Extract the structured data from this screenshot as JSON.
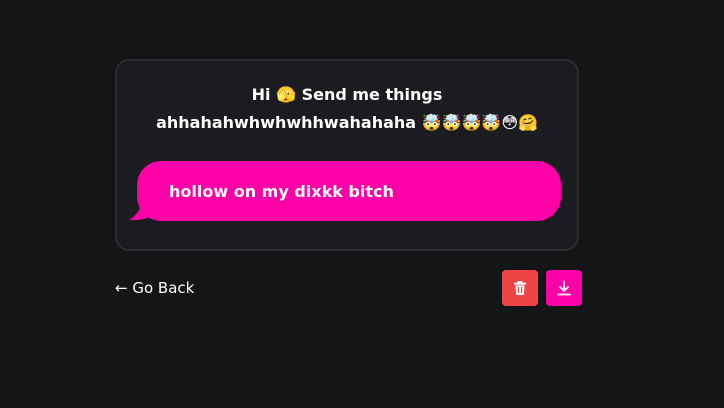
{
  "prompt": {
    "line1": "Hi 🫣 Send me things",
    "line2": "ahhahahwhwhwhhwahahaha 🤯🤯🤯🤯😳🤗"
  },
  "message": {
    "text": "hollow on my dixkk bitch"
  },
  "nav": {
    "back_label": "← Go Back"
  },
  "actions": {
    "delete_icon": "trash-icon",
    "download_icon": "download-icon"
  },
  "colors": {
    "background": "#141517",
    "card": "#1b1c1f",
    "accent": "#ff00a8",
    "danger": "#ef4444"
  }
}
